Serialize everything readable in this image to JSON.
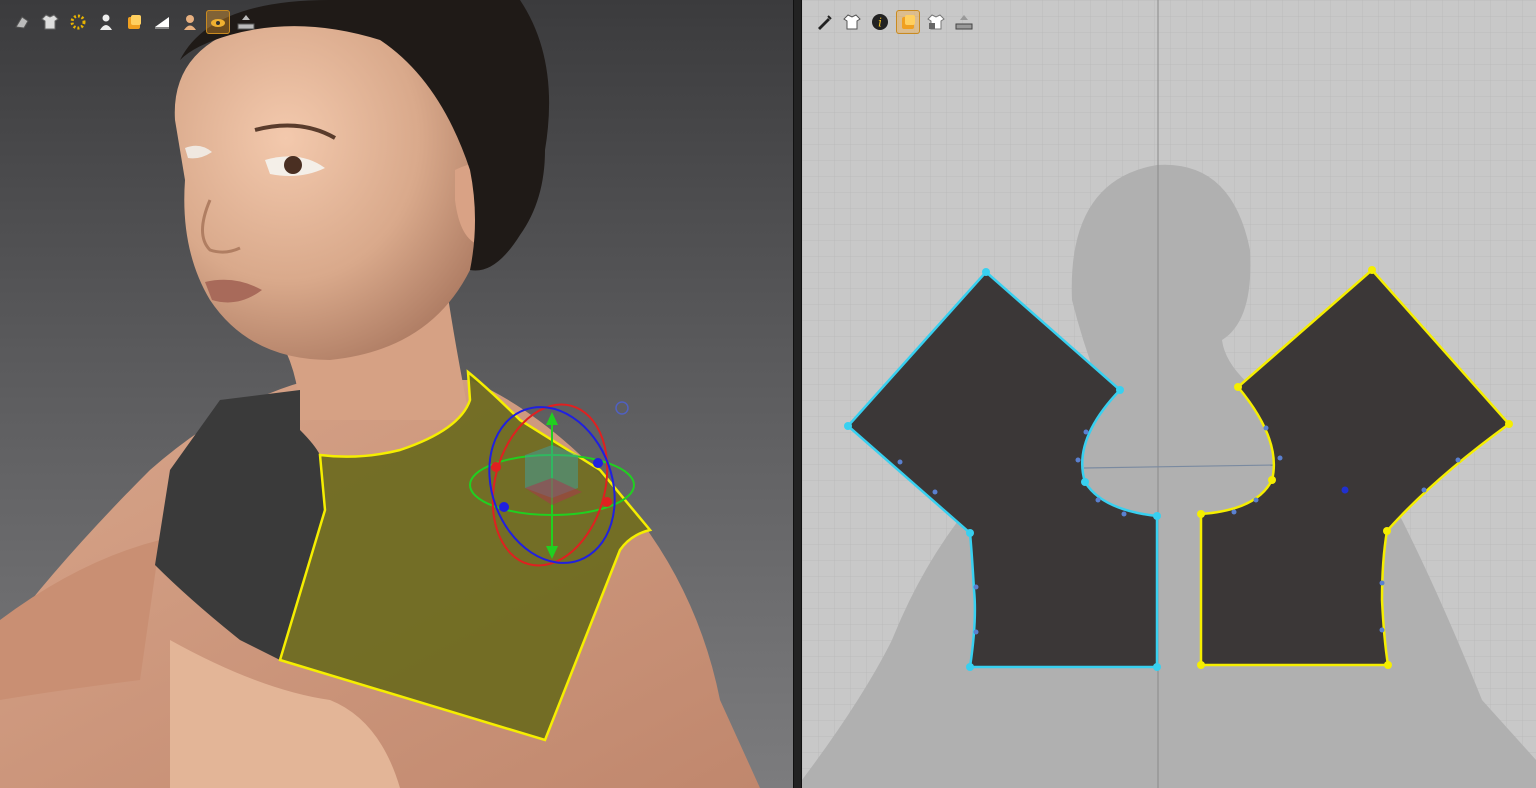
{
  "app": {
    "panels": [
      "3d-viewport",
      "2d-pattern-window"
    ]
  },
  "toolbar_3d": {
    "items": [
      {
        "icon": "avatar-display-icon",
        "active": false
      },
      {
        "icon": "garment-display-icon",
        "active": false
      },
      {
        "icon": "arrangement-points-icon",
        "active": false
      },
      {
        "icon": "avatar-figure-icon",
        "active": false
      },
      {
        "icon": "fabric-texture-icon",
        "active": false
      },
      {
        "icon": "shading-icon",
        "active": false
      },
      {
        "icon": "avatar-skin-icon",
        "active": false
      },
      {
        "icon": "pattern-visibility-icon",
        "active": true
      },
      {
        "icon": "measure-tool-icon",
        "active": false
      }
    ]
  },
  "toolbar_2d": {
    "items": [
      {
        "icon": "edit-pattern-icon",
        "active": false
      },
      {
        "icon": "garment-view-icon",
        "active": false
      },
      {
        "icon": "info-icon",
        "active": false
      },
      {
        "icon": "fabric-view-icon",
        "active": true
      },
      {
        "icon": "lock-garment-icon",
        "active": false
      },
      {
        "icon": "measure-tool-icon",
        "active": false
      }
    ]
  },
  "colors": {
    "selected_outline": "#f5ee00",
    "unselected_outline": "#38d0f0",
    "pattern_fill": "#3b3737",
    "garment_selected": "#6b6a1e",
    "garment_dark": "#3a3a3a",
    "gizmo_x": "#e02020",
    "gizmo_y": "#20d020",
    "gizmo_z": "#2020e0"
  }
}
